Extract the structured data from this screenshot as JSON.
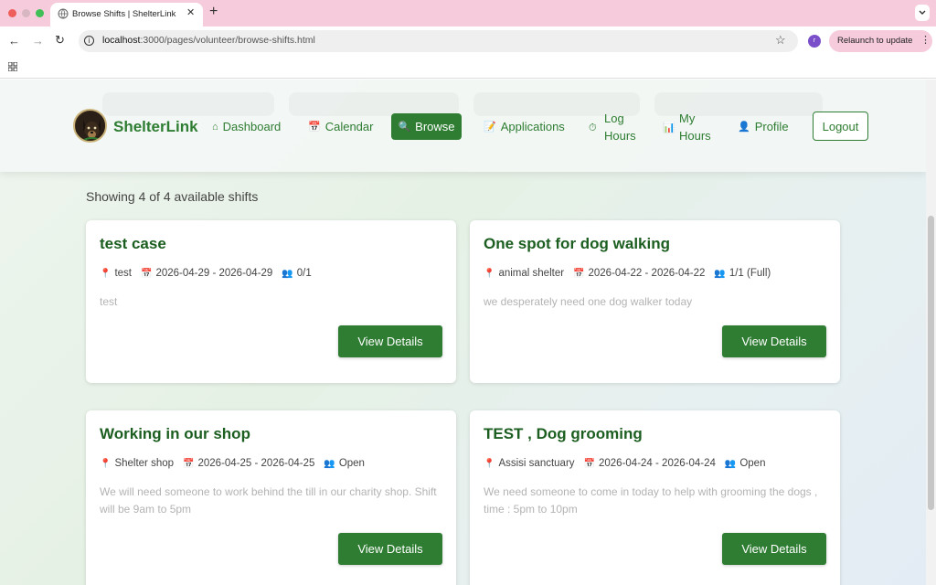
{
  "browser": {
    "tab_title": "Browse Shifts | ShelterLink",
    "url_host": "localhost",
    "url_path": ":3000/pages/volunteer/browse-shifts.html",
    "profile_initial": "r",
    "relaunch_label": "Relaunch to update"
  },
  "nav": {
    "brand": "ShelterLink",
    "items": [
      {
        "label": "Dashboard",
        "icon": "⌂"
      },
      {
        "label": "Calendar",
        "icon": "📅"
      },
      {
        "label": "Browse",
        "icon": "🔍"
      },
      {
        "label": "Applications",
        "icon": "📝"
      },
      {
        "label": "Log Hours",
        "line1": "Log",
        "line2": "Hours",
        "icon": "⏱"
      },
      {
        "label": "My Hours",
        "line1": "My",
        "line2": "Hours",
        "icon": "📊"
      },
      {
        "label": "Profile",
        "icon": "👤"
      }
    ],
    "logout_label": "Logout"
  },
  "results": {
    "count_text": "Showing 4 of 4 available shifts"
  },
  "shifts": [
    {
      "title": "test case",
      "location": "test",
      "dates": "2026-04-29 - 2026-04-29",
      "spots": "0/1",
      "description": "test",
      "button_label": "View Details"
    },
    {
      "title": "One spot for dog walking",
      "location": "animal shelter",
      "dates": "2026-04-22 - 2026-04-22",
      "spots": "1/1 (Full)",
      "description": "we desperately need one dog walker today",
      "button_label": "View Details"
    },
    {
      "title": "Working in our shop",
      "location": "Shelter shop",
      "dates": "2026-04-25 - 2026-04-25",
      "spots": "Open",
      "description": "We will need someone to work behind the till in our charity shop. Shift will be 9am to 5pm",
      "button_label": "View Details"
    },
    {
      "title": "TEST , Dog grooming",
      "location": "Assisi sanctuary",
      "dates": "2026-04-24 - 2026-04-24",
      "spots": "Open",
      "description": "We need someone to come in today to help with grooming the dogs , time : 5pm to 10pm",
      "button_label": "View Details"
    }
  ],
  "icons": {
    "location": "📍",
    "calendar": "📅",
    "people": "👥"
  },
  "colors": {
    "brand_green": "#2e7d32",
    "title_green": "#1b5e20",
    "chrome_pink": "#f6cbdc"
  }
}
